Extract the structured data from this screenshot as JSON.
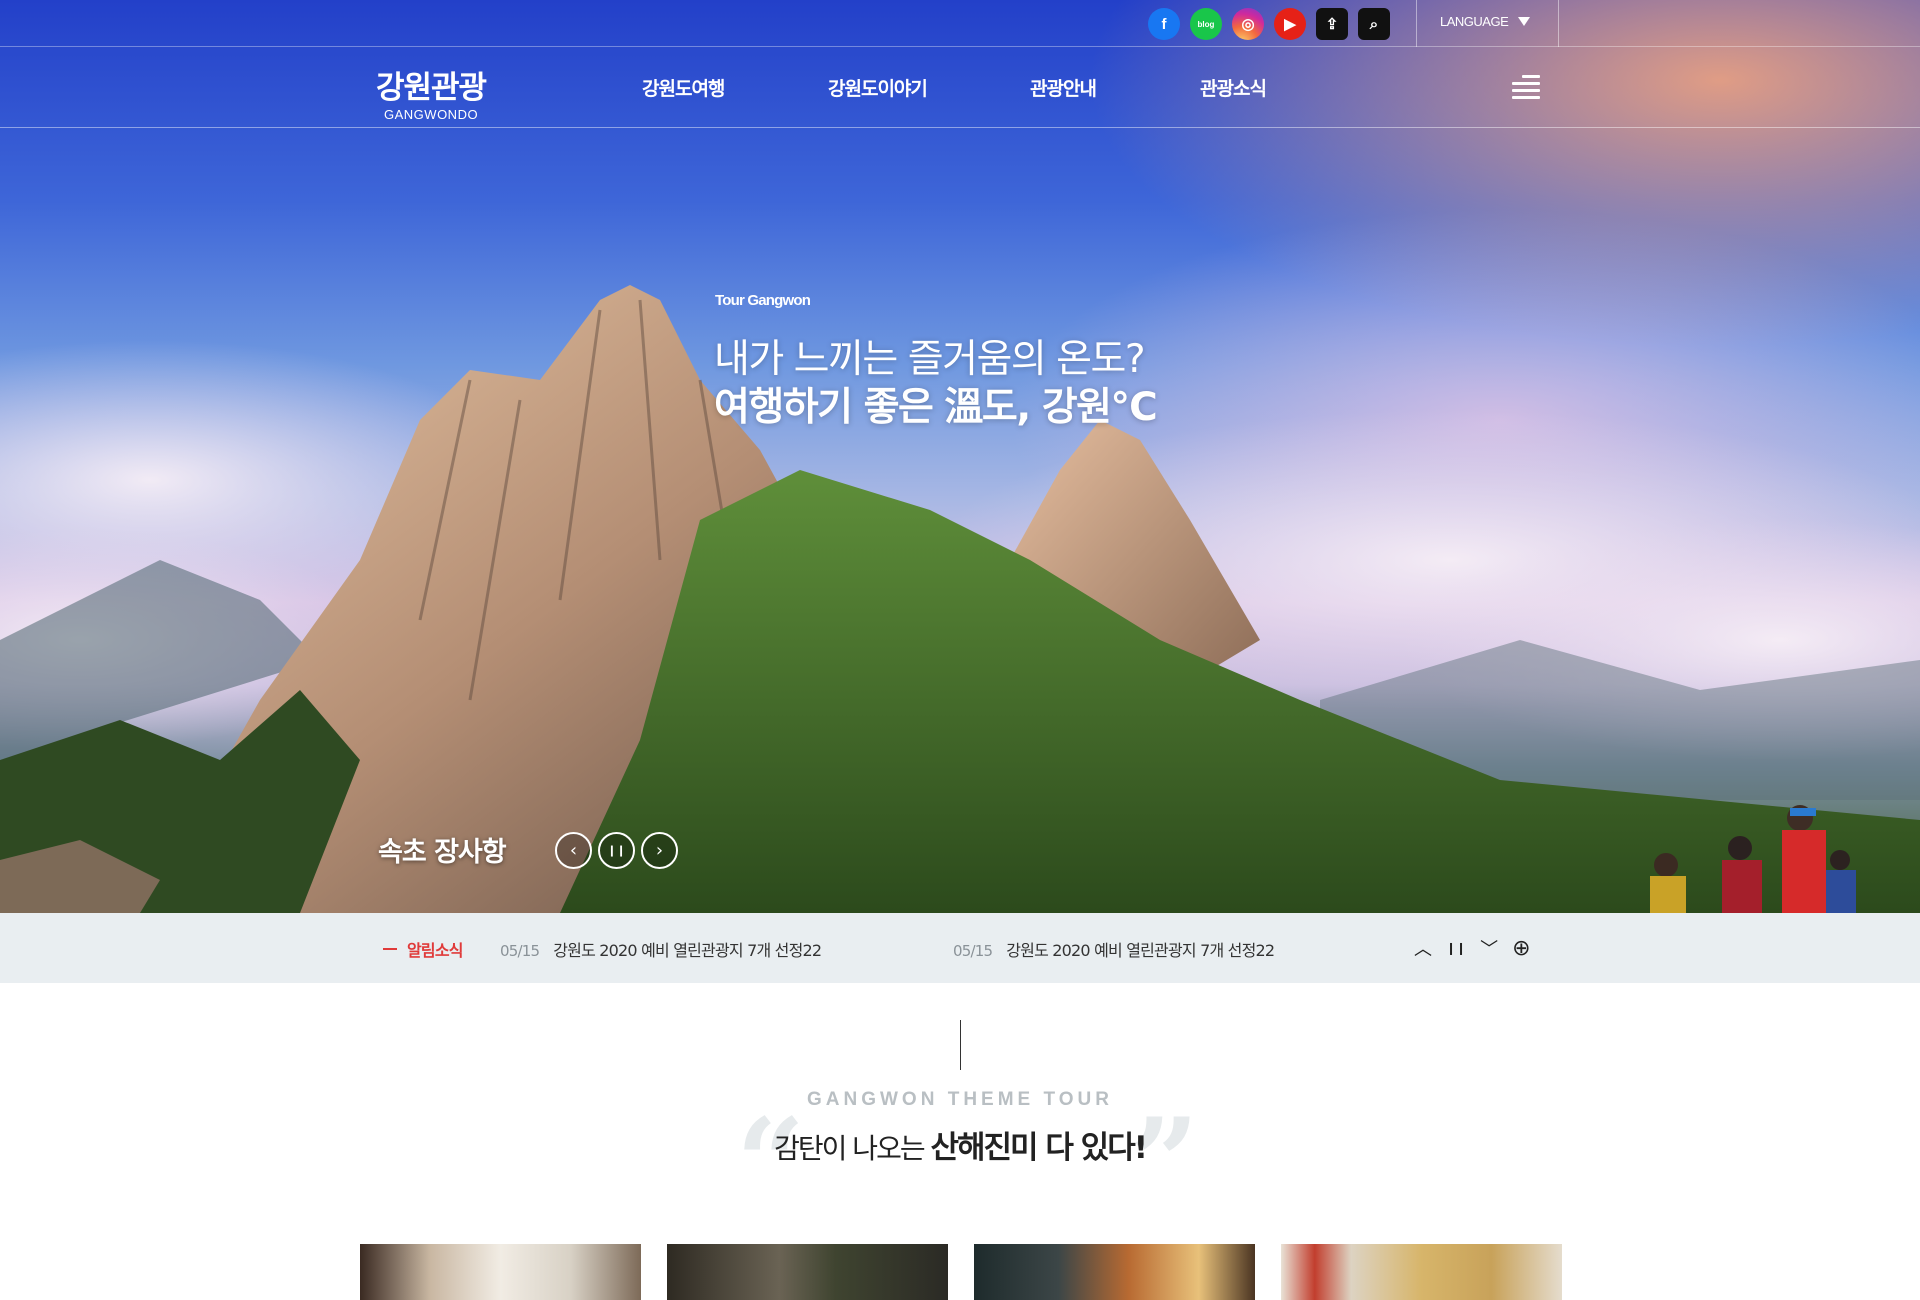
{
  "topbar": {
    "sns": [
      {
        "name": "facebook-icon",
        "glyph": "f"
      },
      {
        "name": "blog-icon",
        "glyph": "blog"
      },
      {
        "name": "instagram-icon",
        "glyph": "◎"
      },
      {
        "name": "youtube-icon",
        "glyph": "▶"
      },
      {
        "name": "share-icon",
        "glyph": "⇪"
      },
      {
        "name": "search-icon",
        "glyph": "⌕"
      }
    ],
    "language_label": "LANGUAGE"
  },
  "nav": {
    "logo_kr": "강원관광",
    "logo_en": "GANGWONDO",
    "menu": [
      "강원도여행",
      "강원도이야기",
      "관광안내",
      "관광소식"
    ]
  },
  "hero": {
    "eyebrow": "Tour Gangwon",
    "headline_line1": "내가 느끼는 즐거움의 온도?",
    "headline_line2": "여행하기 좋은 溫도, 강원℃",
    "slide_caption": "속초 장사항",
    "controls": {
      "prev": "‹",
      "pause": "❙❙",
      "next": "›"
    }
  },
  "notice": {
    "label": "알림소식",
    "items": [
      {
        "date": "05/15",
        "title": "강원도 2020 예비 열린관광지 7개 선정22"
      },
      {
        "date": "05/15",
        "title": "강원도 2020 예비 열린관광지 7개 선정22"
      }
    ],
    "controls": {
      "up": "︿",
      "pause": "❙❙",
      "down": "﹀",
      "more": "⊕"
    }
  },
  "theme": {
    "eyebrow": "GANGWON THEME TOUR",
    "title_light": "감탄이 나오는 ",
    "title_bold": "산해진미 다 있다!"
  },
  "colors": {
    "accent_red": "#e03a3a",
    "notice_bg": "#e9eef1",
    "eyebrow_gray": "#b9bfc3"
  }
}
